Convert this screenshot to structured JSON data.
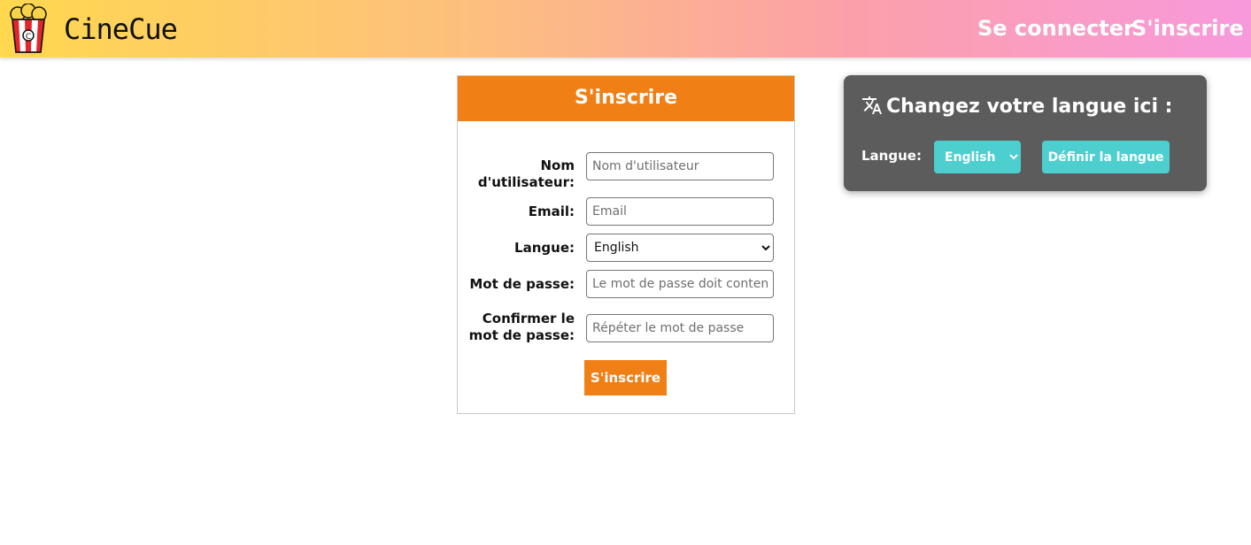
{
  "header": {
    "brand": "CineCue",
    "logo_icon": "popcorn-icon",
    "nav": {
      "login": "Se connecter",
      "signup": "S'inscrire"
    }
  },
  "signup_form": {
    "title": "S'inscrire",
    "username": {
      "label": "Nom d'utilisateur:",
      "placeholder": "Nom d'utilisateur",
      "value": ""
    },
    "email": {
      "label": "Email:",
      "placeholder": "Email",
      "value": ""
    },
    "language": {
      "label": "Langue:",
      "selected": "English"
    },
    "password": {
      "label": "Mot de passe:",
      "placeholder": "Le mot de passe doit contenir",
      "value": ""
    },
    "confirm_password": {
      "label": "Confirmer le mot de passe:",
      "placeholder": "Répéter le mot de passe",
      "value": ""
    },
    "submit_label": "S'inscrire"
  },
  "language_panel": {
    "icon": "translate-icon",
    "title": "Changez votre langue ici :",
    "label": "Langue:",
    "selected": "English",
    "button_label": "Définir la langue"
  },
  "colors": {
    "accent_orange": "#f07f16",
    "accent_teal": "#4ecfcf",
    "panel_gray": "#5c5c5c"
  }
}
